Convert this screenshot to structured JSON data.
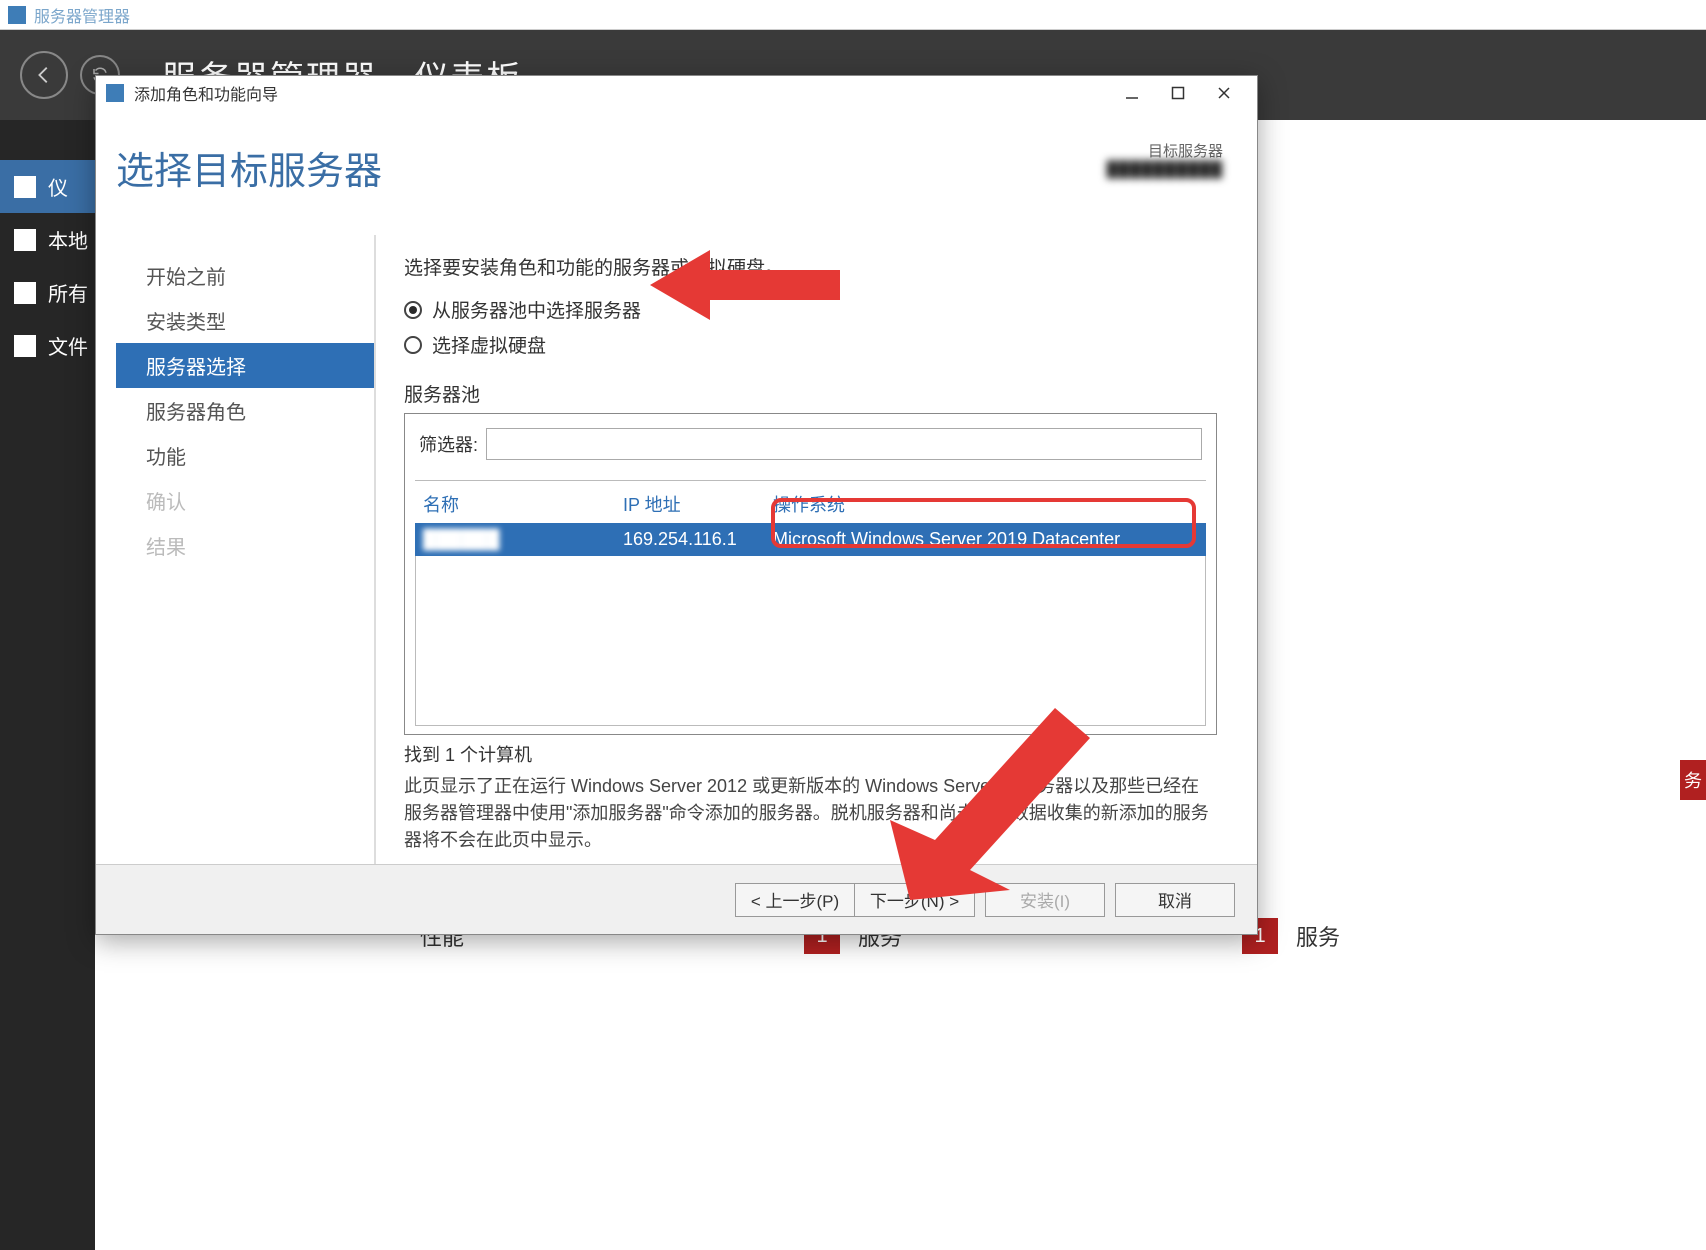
{
  "bg": {
    "app_title": "服务器管理器",
    "breadcrumb": "服务器管理器 · 仪表板",
    "sidebar": [
      {
        "label": "仪",
        "active": true
      },
      {
        "label": "本地"
      },
      {
        "label": "所有"
      },
      {
        "label": "文件"
      }
    ],
    "bottom": {
      "perf": "性能",
      "num": "1",
      "svc": "服务"
    },
    "right_chip": "务"
  },
  "modal": {
    "title": "添加角色和功能向导",
    "heading": "选择目标服务器",
    "target_label": "目标服务器",
    "target_value": "██████████",
    "nav": {
      "before": "开始之前",
      "install_type": "安装类型",
      "server_select": "服务器选择",
      "server_roles": "服务器角色",
      "features": "功能",
      "confirm": "确认",
      "result": "结果"
    },
    "content": {
      "instruction": "选择要安装角色和功能的服务器或虚拟硬盘。",
      "radio_pool": "从服务器池中选择服务器",
      "radio_vhd": "选择虚拟硬盘",
      "pool_label": "服务器池",
      "filter_label": "筛选器:",
      "table": {
        "col_name": "名称",
        "col_ip": "IP 地址",
        "col_os": "操作系统",
        "row": {
          "name": "██████",
          "ip": "169.254.116.1",
          "os": "Microsoft Windows Server 2019 Datacenter"
        }
      },
      "count": "找到 1 个计算机",
      "desc": "此页显示了正在运行 Windows Server 2012 或更新版本的 Windows Server 的服务器以及那些已经在服务器管理器中使用\"添加服务器\"命令添加的服务器。脱机服务器和尚未完成数据收集的新添加的服务器将不会在此页中显示。"
    },
    "footer": {
      "prev": "< 上一步(P)",
      "next": "下一步(N) >",
      "install": "安装(I)",
      "cancel": "取消"
    }
  }
}
